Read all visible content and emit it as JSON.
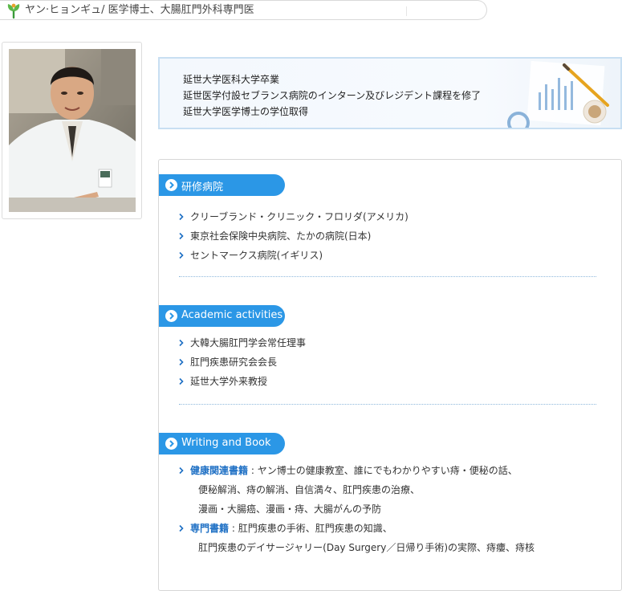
{
  "header": {
    "title": "ヤン·ヒョンギュ/ 医学博士、大腸肛門外科専門医",
    "logo_icon": "hospital-leaf-logo-icon",
    "accent_color": "#2b97e6"
  },
  "education": {
    "lines": [
      "延世大学医科大学卒業",
      "延世医学付設セブランス病院のインターン及びレジデント課程を修了",
      "延世大学医学博士の学位取得"
    ]
  },
  "sections": [
    {
      "title": "研修病院",
      "items": [
        "クリーブランド・クリニック・フロリダ(アメリカ)",
        "東京社会保険中央病院、たかの病院(日本)",
        "セントマークス病院(イギリス)"
      ]
    },
    {
      "title": "Academic activities",
      "items": [
        "大韓大腸肛門学会常任理事",
        "肛門疾患研究会会長",
        "延世大学外来教授"
      ]
    },
    {
      "title": "Writing and Book",
      "entries": [
        {
          "key": "健康関連書籍",
          "first": " : ヤン博士の健康教室、誰にでもわかりやすい痔・便秘の話、",
          "cont": [
            "便秘解消、痔の解消、自信満々、肛門疾患の治療、",
            "漫画・大腸癌、漫画・痔、大腸がんの予防"
          ]
        },
        {
          "key": "専門書籍",
          "first": " : 肛門疾患の手術、肛門疾患の知識、",
          "cont": [
            "肛門疾患のデイサージャリー(Day Surgery／日帰り手術)の実際、痔瘻、痔核"
          ]
        }
      ]
    }
  ]
}
